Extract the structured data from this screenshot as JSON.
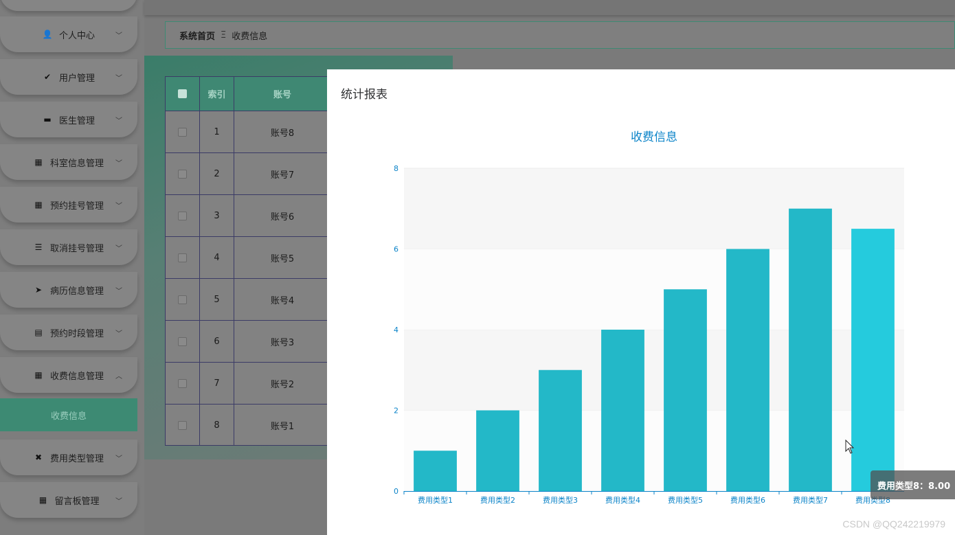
{
  "sidebar": {
    "items": [
      {
        "label": "个人中心",
        "icon": "user-icon",
        "glyph": "👤"
      },
      {
        "label": "用户管理",
        "icon": "clipboard-check-icon",
        "glyph": "✔"
      },
      {
        "label": "医生管理",
        "icon": "store-icon",
        "glyph": "▬"
      },
      {
        "label": "科室信息管理",
        "icon": "grid-icon",
        "glyph": "▦"
      },
      {
        "label": "预约挂号管理",
        "icon": "grid-icon",
        "glyph": "▦"
      },
      {
        "label": "取消挂号管理",
        "icon": "sliders-icon",
        "glyph": "☰"
      },
      {
        "label": "病历信息管理",
        "icon": "paper-plane-icon",
        "glyph": "➤"
      },
      {
        "label": "预约时段管理",
        "icon": "clipboard-icon",
        "glyph": "▤"
      },
      {
        "label": "收费信息管理",
        "icon": "grid-icon",
        "glyph": "▦",
        "expanded": true
      },
      {
        "label": "费用类型管理",
        "icon": "ticket-icon",
        "glyph": "✖"
      },
      {
        "label": "留言板管理",
        "icon": "grid-icon",
        "glyph": "▦"
      }
    ],
    "active_sub": "收费信息"
  },
  "breadcrumb": {
    "home": "系统首页",
    "separator": "Ξ",
    "current": "收费信息"
  },
  "table": {
    "headers": {
      "index": "索引",
      "account": "账号"
    },
    "rows": [
      {
        "index": "1",
        "account": "账号8"
      },
      {
        "index": "2",
        "account": "账号7"
      },
      {
        "index": "3",
        "account": "账号6"
      },
      {
        "index": "4",
        "account": "账号5"
      },
      {
        "index": "5",
        "account": "账号4"
      },
      {
        "index": "6",
        "account": "账号3"
      },
      {
        "index": "7",
        "account": "账号2"
      },
      {
        "index": "8",
        "account": "账号1"
      }
    ]
  },
  "dialog": {
    "title": "统计报表"
  },
  "tooltip": {
    "text": "费用类型8：8.00"
  },
  "watermark": "CSDN @QQ242219979",
  "colors": {
    "accent": "#3f8873",
    "bar": "#23b8c8",
    "bar_hover": "#25cbdd",
    "axis": "#0a83c8"
  },
  "chart_data": {
    "type": "bar",
    "title": "收费信息",
    "categories": [
      "费用类型1",
      "费用类型2",
      "费用类型3",
      "费用类型4",
      "费用类型5",
      "费用类型6",
      "费用类型7",
      "费用类型8"
    ],
    "values": [
      1,
      2,
      3,
      4,
      5,
      6,
      7,
      6.5
    ],
    "ylim": [
      0,
      8
    ],
    "yticks": [
      "0",
      "2",
      "4",
      "6",
      "8"
    ],
    "xlabel": "",
    "ylabel": "",
    "grid": true
  }
}
